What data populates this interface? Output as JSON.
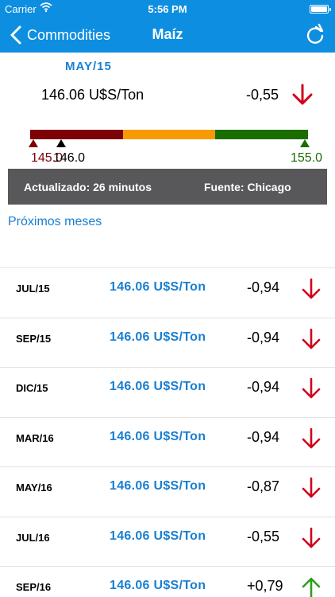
{
  "status": {
    "carrier": "Carrier",
    "time": "5:56 PM"
  },
  "nav": {
    "back_label": "Commodities",
    "title": "Maíz"
  },
  "current": {
    "month": "MAY/15",
    "price": "146.06 U$S/Ton",
    "change": "-0,55",
    "direction": "down"
  },
  "range": {
    "low_label": "145.0",
    "current_label": "146.0",
    "high_label": "155.0",
    "colors": [
      "#7d0006",
      "#f99a04",
      "#1a6e00"
    ]
  },
  "info": {
    "updated": "Actualizado: 26 minutos",
    "source": "Fuente: Chicago"
  },
  "section_title": "Próximos meses",
  "rows": [
    {
      "month": "JUL/15",
      "price": "146.06 U$S/Ton",
      "change": "-0,94",
      "direction": "down"
    },
    {
      "month": "SEP/15",
      "price": "146.06 U$S/Ton",
      "change": "-0,94",
      "direction": "down"
    },
    {
      "month": "DIC/15",
      "price": "146.06 U$S/Ton",
      "change": "-0,94",
      "direction": "down"
    },
    {
      "month": "MAR/16",
      "price": "146.06 U$S/Ton",
      "change": "-0,94",
      "direction": "down"
    },
    {
      "month": "MAY/16",
      "price": "146.06 U$S/Ton",
      "change": "-0,87",
      "direction": "down"
    },
    {
      "month": "JUL/16",
      "price": "146.06 U$S/Ton",
      "change": "-0,55",
      "direction": "down"
    },
    {
      "month": "SEP/16",
      "price": "146.06 U$S/Ton",
      "change": "+0,79",
      "direction": "up"
    }
  ],
  "colors": {
    "accent": "#0d8ee0",
    "link": "#1a7fd0",
    "down": "#d0021b",
    "up": "#2e9e1f",
    "infobar": "#58585a"
  }
}
